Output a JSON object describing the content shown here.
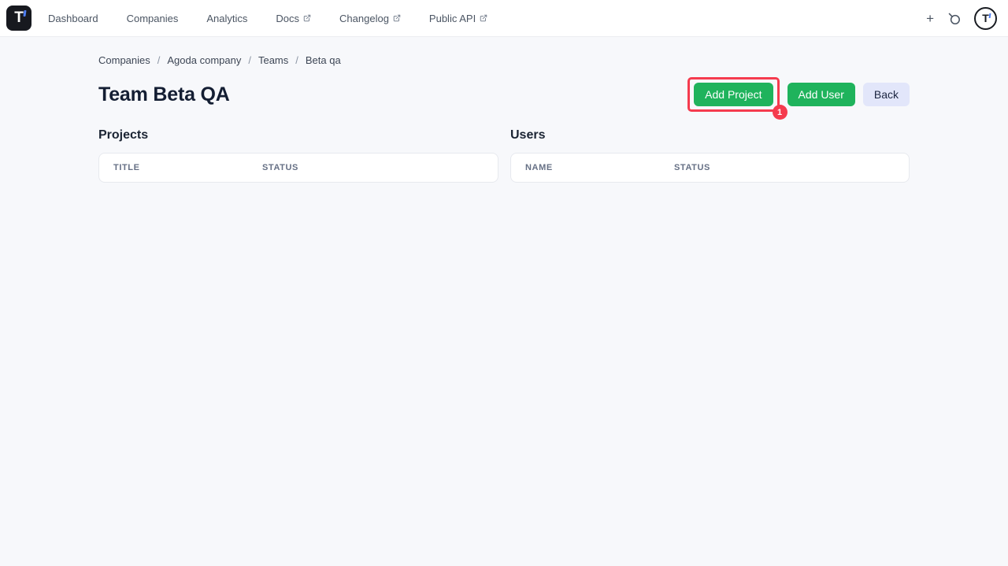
{
  "nav": {
    "brand_letter": "T",
    "items": [
      {
        "label": "Dashboard",
        "external": false
      },
      {
        "label": "Companies",
        "external": false
      },
      {
        "label": "Analytics",
        "external": false
      },
      {
        "label": "Docs",
        "external": true
      },
      {
        "label": "Changelog",
        "external": true
      },
      {
        "label": "Public API",
        "external": true
      }
    ],
    "plus_glyph": "+",
    "avatar_letter": "T"
  },
  "breadcrumb": {
    "separator": "/",
    "items": [
      "Companies",
      "Agoda company",
      "Teams",
      "Beta qa"
    ]
  },
  "page": {
    "title": "Team Beta QA"
  },
  "actions": {
    "add_project_label": "Add Project",
    "add_user_label": "Add User",
    "back_label": "Back"
  },
  "annotation": {
    "step_number": "1",
    "color": "#f53b4e",
    "target": "Add Project button"
  },
  "sections": {
    "projects": {
      "heading": "Projects",
      "columns": [
        "TITLE",
        "STATUS"
      ],
      "rows": []
    },
    "users": {
      "heading": "Users",
      "columns": [
        "NAME",
        "STATUS"
      ],
      "rows": []
    }
  },
  "colors": {
    "accent_green": "#1fb35c",
    "back_button_bg": "#e2e6fa",
    "annotation_red": "#f53b4e",
    "brand_blue": "#4d7df2",
    "page_bg": "#f7f8fb"
  }
}
